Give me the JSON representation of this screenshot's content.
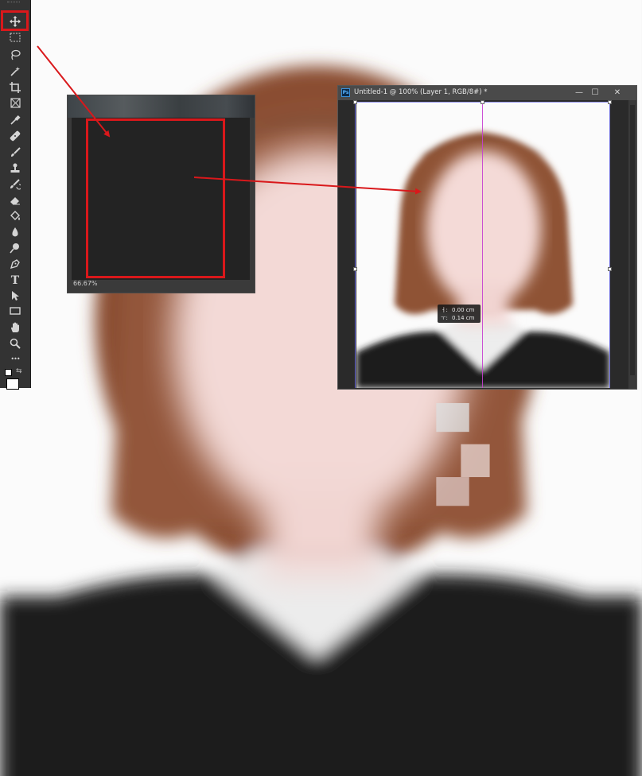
{
  "toolbar": {
    "tools": [
      {
        "name": "move-tool",
        "icon": "move-icon"
      },
      {
        "name": "marquee-tool",
        "icon": "rectangular-marquee-icon"
      },
      {
        "name": "lasso-tool",
        "icon": "lasso-icon"
      },
      {
        "name": "magic-wand-tool",
        "icon": "magic-wand-icon"
      },
      {
        "name": "crop-tool",
        "icon": "crop-icon"
      },
      {
        "name": "frame-tool",
        "icon": "frame-icon"
      },
      {
        "name": "eyedropper-tool",
        "icon": "eyedropper-icon"
      },
      {
        "name": "healing-brush-tool",
        "icon": "bandage-icon"
      },
      {
        "name": "brush-tool",
        "icon": "brush-icon"
      },
      {
        "name": "clone-stamp-tool",
        "icon": "stamp-icon"
      },
      {
        "name": "history-brush-tool",
        "icon": "history-brush-icon"
      },
      {
        "name": "eraser-tool",
        "icon": "eraser-icon"
      },
      {
        "name": "paint-bucket-tool",
        "icon": "paint-bucket-icon"
      },
      {
        "name": "blur-tool",
        "icon": "drop-icon"
      },
      {
        "name": "dodge-tool",
        "icon": "dodge-icon"
      },
      {
        "name": "pen-tool",
        "icon": "pen-icon"
      },
      {
        "name": "type-tool",
        "icon": "type-icon"
      },
      {
        "name": "path-selection-tool",
        "icon": "arrow-icon"
      },
      {
        "name": "rectangle-tool",
        "icon": "rectangle-icon"
      },
      {
        "name": "hand-tool",
        "icon": "hand-icon"
      },
      {
        "name": "zoom-tool",
        "icon": "zoom-icon"
      },
      {
        "name": "more-tools",
        "icon": "ellipsis-icon"
      }
    ],
    "type_glyph": "T",
    "more_glyph": "•••"
  },
  "small_doc": {
    "zoom": "66.67%"
  },
  "main_doc": {
    "ps_badge": "Ps",
    "title": "Untitled-1 @ 100% (Layer 1, RGB/8#) *",
    "minimize": "—",
    "maximize": "☐",
    "close": "✕"
  },
  "measure": {
    "dx_label": "ㅓ:",
    "dx_value": "0.00 cm",
    "dy_label": "ㅜ:",
    "dy_value": "0.14 cm"
  },
  "colors": {
    "annotation_red": "#d9181b",
    "guide_magenta": "#c53fd0"
  }
}
